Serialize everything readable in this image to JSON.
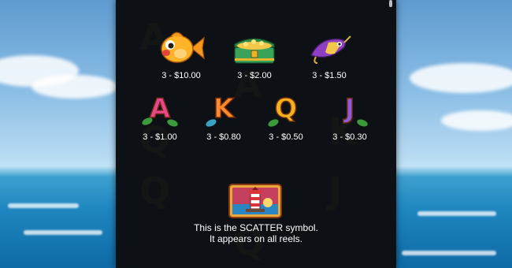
{
  "paytable": {
    "row1": [
      {
        "icon": "goldfish-icon",
        "payout": "3 - $10.00"
      },
      {
        "icon": "treasure-chest-icon",
        "payout": "3 - $2.00"
      },
      {
        "icon": "fishing-lure-icon",
        "payout": "3 - $1.50"
      }
    ],
    "row2": [
      {
        "icon": "letter-a-icon",
        "letter": "A",
        "color": "#e8488a",
        "payout": "3 - $1.00"
      },
      {
        "icon": "letter-k-icon",
        "letter": "K",
        "color": "#ff8a2a",
        "payout": "3 - $0.80"
      },
      {
        "icon": "letter-q-icon",
        "letter": "Q",
        "color": "#f2b21d",
        "payout": "3 - $0.50"
      },
      {
        "icon": "letter-j-icon",
        "letter": "J",
        "color": "#8f5bd8",
        "payout": "3 - $0.30"
      }
    ]
  },
  "scatter": {
    "icon": "lighthouse-scatter-icon",
    "line1": "This is the SCATTER symbol.",
    "line2": "It appears on all reels."
  },
  "colors": {
    "panel": "#0d1116",
    "text": "#ffffff"
  }
}
